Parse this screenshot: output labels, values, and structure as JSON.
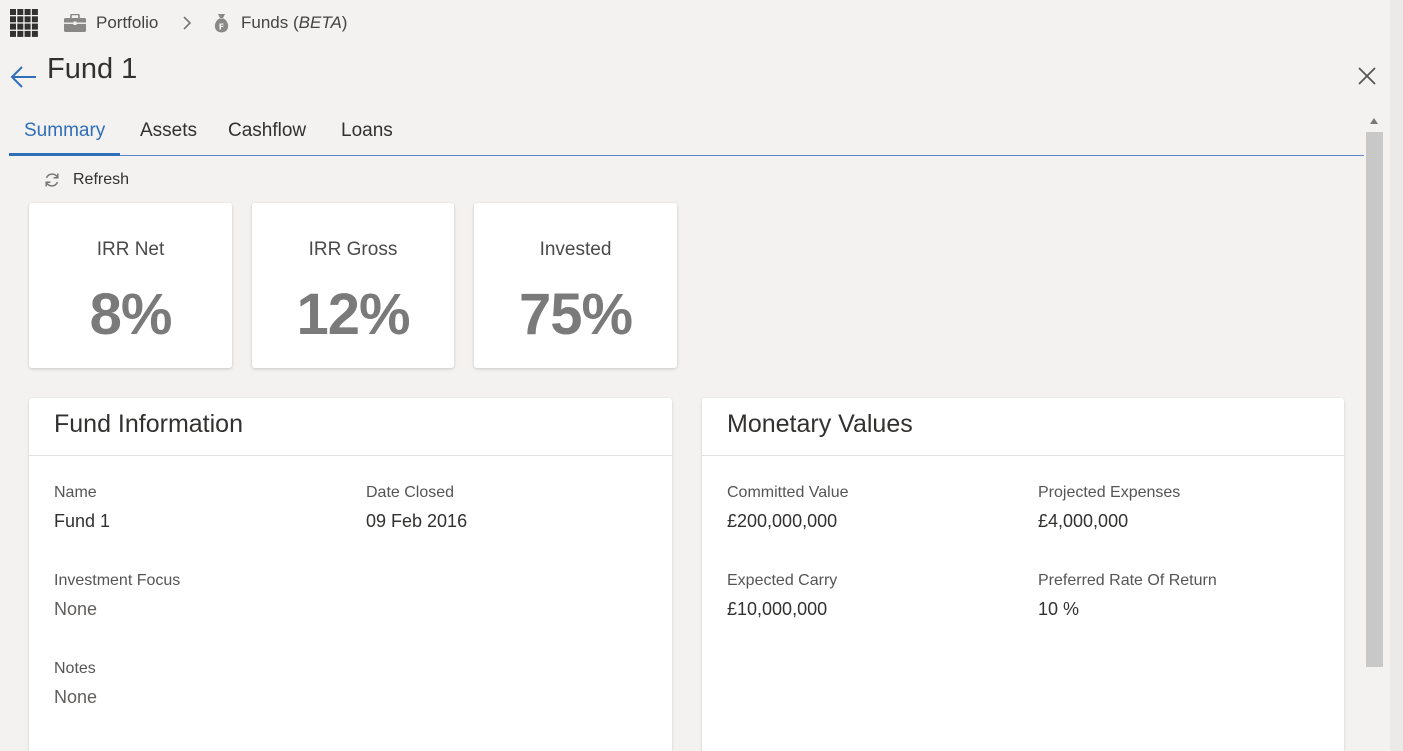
{
  "breadcrumb": {
    "items": [
      {
        "label": "Portfolio",
        "icon": "briefcase-icon"
      },
      {
        "label": "Funds (",
        "label_em": "BETA",
        "label_end": ")",
        "icon": "money-bag-icon"
      }
    ],
    "separator_icon": "chevron-right-icon"
  },
  "header": {
    "title": "Fund 1",
    "back_icon": "arrow-left-icon",
    "close_icon": "close-icon"
  },
  "tabs": [
    {
      "label": "Summary",
      "active": true
    },
    {
      "label": "Assets",
      "active": false
    },
    {
      "label": "Cashflow",
      "active": false
    },
    {
      "label": "Loans",
      "active": false
    }
  ],
  "toolbar": {
    "refresh_label": "Refresh",
    "refresh_icon": "refresh-icon"
  },
  "kpis": [
    {
      "label": "IRR Net",
      "value": "8%"
    },
    {
      "label": "IRR Gross",
      "value": "12%"
    },
    {
      "label": "Invested",
      "value": "75%"
    }
  ],
  "fund_information": {
    "title": "Fund Information",
    "fields": [
      {
        "label": "Name",
        "value": "Fund 1"
      },
      {
        "label": "Date Closed",
        "value": "09 Feb 2016"
      },
      {
        "label": "Investment Focus",
        "value": "None"
      },
      {
        "label": "Notes",
        "value": "None"
      }
    ]
  },
  "monetary_values": {
    "title": "Monetary Values",
    "fields": [
      {
        "label": "Committed Value",
        "value": "£200,000,000"
      },
      {
        "label": "Projected Expenses",
        "value": "£4,000,000"
      },
      {
        "label": "Expected Carry",
        "value": "£10,000,000"
      },
      {
        "label": "Preferred Rate Of Return",
        "value": "10 %"
      }
    ]
  },
  "colors": {
    "accent": "#2f6fb8",
    "background": "#f3f2f1",
    "kpi_value": "#7a7a7a"
  }
}
